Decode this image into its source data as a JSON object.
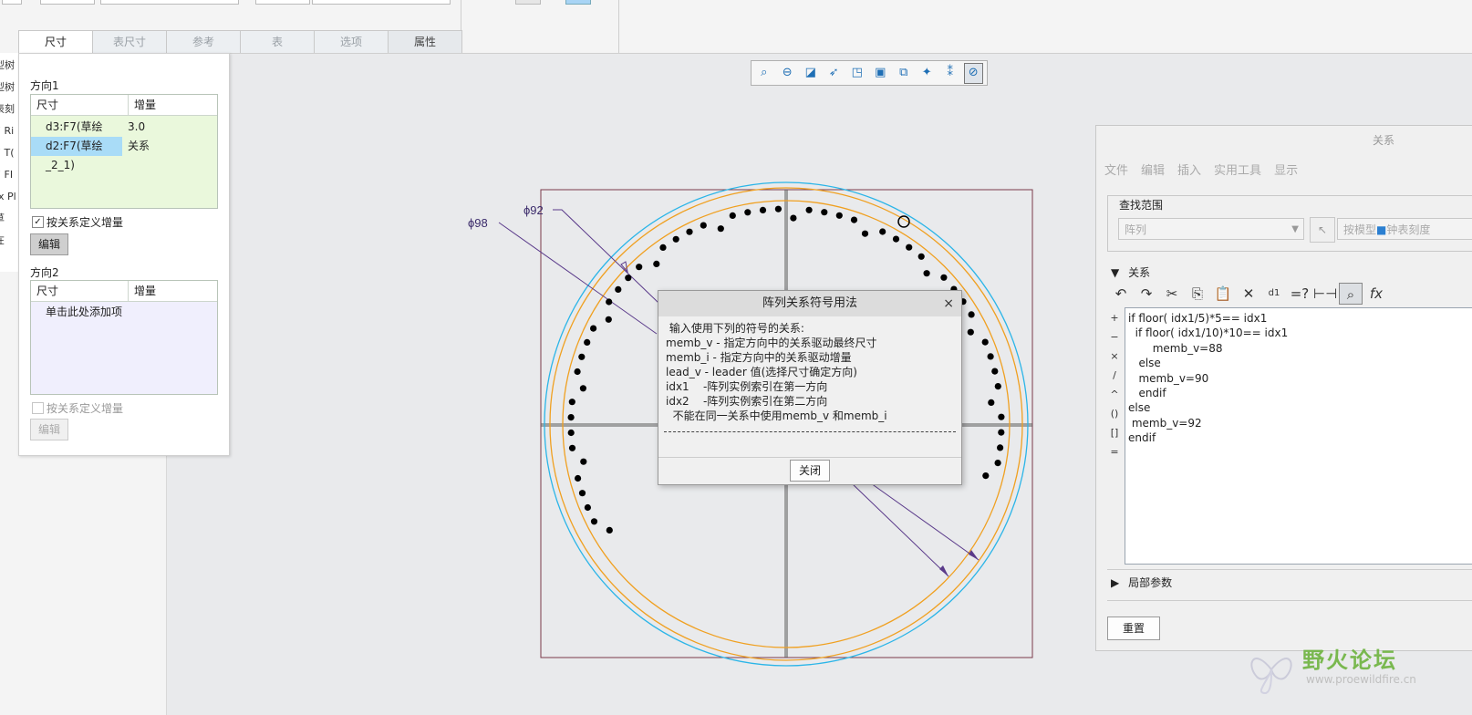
{
  "tabs": [
    {
      "label": "尺寸",
      "active": true
    },
    {
      "label": "表尺寸",
      "active": false
    },
    {
      "label": "参考",
      "active": false
    },
    {
      "label": "表",
      "active": false
    },
    {
      "label": "选项",
      "active": false
    },
    {
      "label": "属性",
      "active": false
    }
  ],
  "tree": {
    "items": [
      "型树",
      "型树",
      "表刻",
      "7 Ri",
      "7 T(",
      "7 FI",
      "-x Pl",
      "草",
      "在",
      "*"
    ]
  },
  "dim_panel": {
    "dir1_title": "方向1",
    "col_dim": "尺寸",
    "col_inc": "增量",
    "rows": [
      {
        "dim": "d3:F7(草绘_2_1)",
        "inc": "3.0",
        "selected": false
      },
      {
        "dim": "d2:F7(草绘_2_1)",
        "inc": "关系",
        "selected": true
      }
    ],
    "check1_label": "按关系定义增量",
    "check1_checked": true,
    "edit1_label": "编辑",
    "dir2_title": "方向2",
    "add_item": "单击此处添加项",
    "check2_label": "按关系定义增量",
    "check2_checked": false,
    "edit2_label": "编辑"
  },
  "toolbar": {
    "icons": [
      "zoom-fit-icon",
      "zoom-out-icon",
      "repaint-icon",
      "orient-icon",
      "saved-views-icon",
      "display-style-icon",
      "view-manager-icon",
      "appearance-icon",
      "annotation-display-icon",
      "spin-center-icon"
    ]
  },
  "canvas": {
    "label_98": "ϕ98",
    "label_92": "ϕ92",
    "colors": {
      "outer_circle": "#2bb5e8",
      "inner_circle": "#f0a020",
      "frame": "#7a3a4a",
      "leader": "#5a3a8a"
    }
  },
  "dialog": {
    "title": "阵列关系符号用法",
    "close_x": "×",
    "lines": [
      " 输入使用下列的符号的关系:",
      "memb_v - 指定方向中的关系驱动最终尺寸",
      "memb_i - 指定方向中的关系驱动增量",
      "lead_v - leader 值(选择尺寸确定方向)",
      "idx1    -阵列实例索引在第一方向",
      "idx2    -阵列实例索引在第二方向",
      "  不能在同一关系中使用memb_v 和memb_i"
    ],
    "close_btn": "关闭"
  },
  "relations": {
    "title": "关系",
    "menu": [
      "文件",
      "编辑",
      "插入",
      "实用工具",
      "显示"
    ],
    "scope_label": "查找范围",
    "scope_value": "阵列",
    "scope_value2": "按模型",
    "scope_value3": "钟表刻度",
    "section_label": "关系",
    "ops": [
      "+",
      "−",
      "×",
      "/",
      "^",
      "()",
      "[]",
      "="
    ],
    "code": [
      "if floor( idx1/5)*5== idx1",
      "  if floor( idx1/10)*10== idx1",
      "       memb_v=88",
      "   else",
      "   memb_v=90",
      "   endif",
      "else",
      " memb_v=92",
      "endif"
    ],
    "local_params": "局部参数",
    "reset_btn": "重置",
    "fx": "fx"
  },
  "watermark": {
    "brand": "野火论坛",
    "url": "www.proewildfire.cn"
  }
}
